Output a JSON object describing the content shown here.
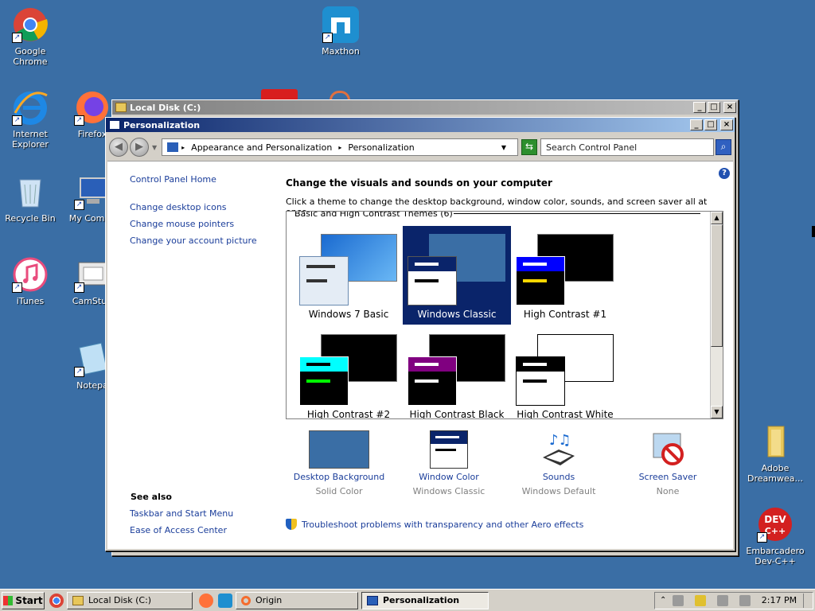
{
  "desktop": {
    "icons": [
      {
        "label": "Google Chrome"
      },
      {
        "label": "Maxthon"
      },
      {
        "label": "Internet Explorer"
      },
      {
        "label": "Firefox"
      },
      {
        "label": "Recycle Bin"
      },
      {
        "label": "My Compu"
      },
      {
        "label": "iTunes"
      },
      {
        "label": "CamStud"
      },
      {
        "label": "Notepa"
      },
      {
        "label": "Adobe Dreamwea..."
      },
      {
        "label": "Embarcadero Dev-C++"
      }
    ]
  },
  "background_window": {
    "title": "Local Disk (C:)"
  },
  "window": {
    "title": "Personalization",
    "breadcrumb": [
      "Appearance and Personalization",
      "Personalization"
    ],
    "search_placeholder": "Search Control Panel",
    "sidebar": {
      "home": "Control Panel Home",
      "links": [
        "Change desktop icons",
        "Change mouse pointers",
        "Change your account picture"
      ],
      "see_also_title": "See also",
      "see_also": [
        "Taskbar and Start Menu",
        "Ease of Access Center"
      ]
    },
    "heading": "Change the visuals and sounds on your computer",
    "subheading": "Click a theme to change the desktop background, window color, sounds, and screen saver all at once.",
    "group_title": "Basic and High Contrast Themes (6)",
    "themes": [
      {
        "name": "Windows 7 Basic",
        "selected": false
      },
      {
        "name": "Windows Classic",
        "selected": true
      },
      {
        "name": "High Contrast #1",
        "selected": false
      },
      {
        "name": "High Contrast #2",
        "selected": false
      },
      {
        "name": "High Contrast Black",
        "selected": false
      },
      {
        "name": "High Contrast White",
        "selected": false
      }
    ],
    "bottom": [
      {
        "label": "Desktop Background",
        "sub": "Solid Color"
      },
      {
        "label": "Window Color",
        "sub": "Windows Classic"
      },
      {
        "label": "Sounds",
        "sub": "Windows Default"
      },
      {
        "label": "Screen Saver",
        "sub": "None"
      }
    ],
    "troubleshoot": "Troubleshoot problems with transparency and other Aero effects"
  },
  "taskbar": {
    "start": "Start",
    "tasks": [
      {
        "label": "Local Disk (C:)",
        "active": false
      },
      {
        "label": "Origin",
        "active": false
      },
      {
        "label": "Personalization",
        "active": true
      }
    ],
    "clock": "2:17 PM"
  },
  "colors": {
    "desktop": "#3a6ea5",
    "selection": "#0a246a",
    "link": "#1a3d9a"
  }
}
